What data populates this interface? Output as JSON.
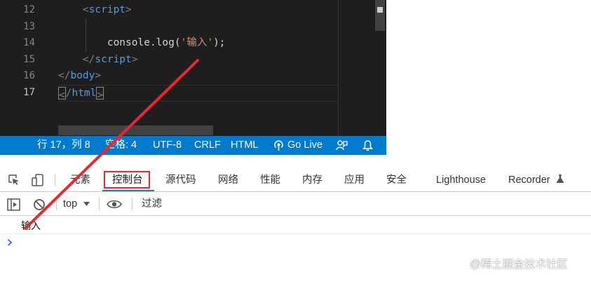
{
  "editor": {
    "line_numbers": [
      "12",
      "13",
      "14",
      "15",
      "16",
      "17"
    ],
    "code": {
      "l12_tag": "script",
      "l14_console": "console.log(",
      "l14_string": "'输入'",
      "l14_end": ");",
      "l15_tag": "script",
      "l16_tag": "body",
      "l17_tag": "html"
    },
    "statusbar": {
      "position": "行 17，列 8",
      "spaces": "空格: 4",
      "encoding": "UTF-8",
      "eol": "CRLF",
      "language": "HTML",
      "go_live": "Go Live"
    }
  },
  "devtools": {
    "tabs": [
      "元素",
      "控制台",
      "源代码",
      "网络",
      "性能",
      "内存",
      "应用",
      "安全",
      "Lighthouse",
      "Recorder"
    ],
    "active_tab": "控制台",
    "toolbar": {
      "context": "top",
      "filter_placeholder": "过滤"
    },
    "console": {
      "messages": [
        "输入"
      ],
      "prompt": "›"
    }
  },
  "watermark": "@稀土掘金技术社区",
  "colors": {
    "statusbar": "#007acc",
    "editor_bg": "#1e1e1e",
    "tag": "#569cd6",
    "string": "#ce9178",
    "annotation": "#e8272e",
    "active_underline": "#1a73e8"
  }
}
